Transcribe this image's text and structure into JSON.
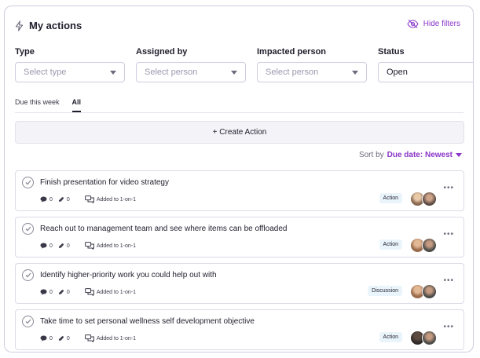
{
  "header": {
    "title": "My actions",
    "hide_filters_label": "Hide filters"
  },
  "filters": [
    {
      "label": "Type",
      "value": "Select type",
      "filled": false
    },
    {
      "label": "Assigned by",
      "value": "Select person",
      "filled": false
    },
    {
      "label": "Impacted person",
      "value": "Select person",
      "filled": false
    },
    {
      "label": "Status",
      "value": "Open",
      "filled": true
    }
  ],
  "tabs": [
    {
      "label": "Due this week",
      "active": false
    },
    {
      "label": "All",
      "active": true
    }
  ],
  "create_action_label": "+ Create Action",
  "sort": {
    "prefix": "Sort by",
    "value": "Due date: Newest"
  },
  "actions": [
    {
      "title": "Finish presentation for video strategy",
      "comments": "0",
      "attachments": "0",
      "added": "Added to 1-on-1",
      "badge": "Action"
    },
    {
      "title": "Reach out to management team and see where items can be offloaded",
      "comments": "0",
      "attachments": "0",
      "added": "Added to 1-on-1",
      "badge": "Action"
    },
    {
      "title": "Identify higher-priority work you could help out with",
      "comments": "0",
      "attachments": "0",
      "added": "Added to 1-on-1",
      "badge": "Discussion"
    },
    {
      "title": "Take time to set personal wellness self development objective",
      "comments": "0",
      "attachments": "0",
      "added": "Added to 1-on-1",
      "badge": "Action"
    }
  ],
  "colors": {
    "accent": "#8a35c9",
    "border": "#cfcce0",
    "badge_bg": "#eaf4fb"
  }
}
